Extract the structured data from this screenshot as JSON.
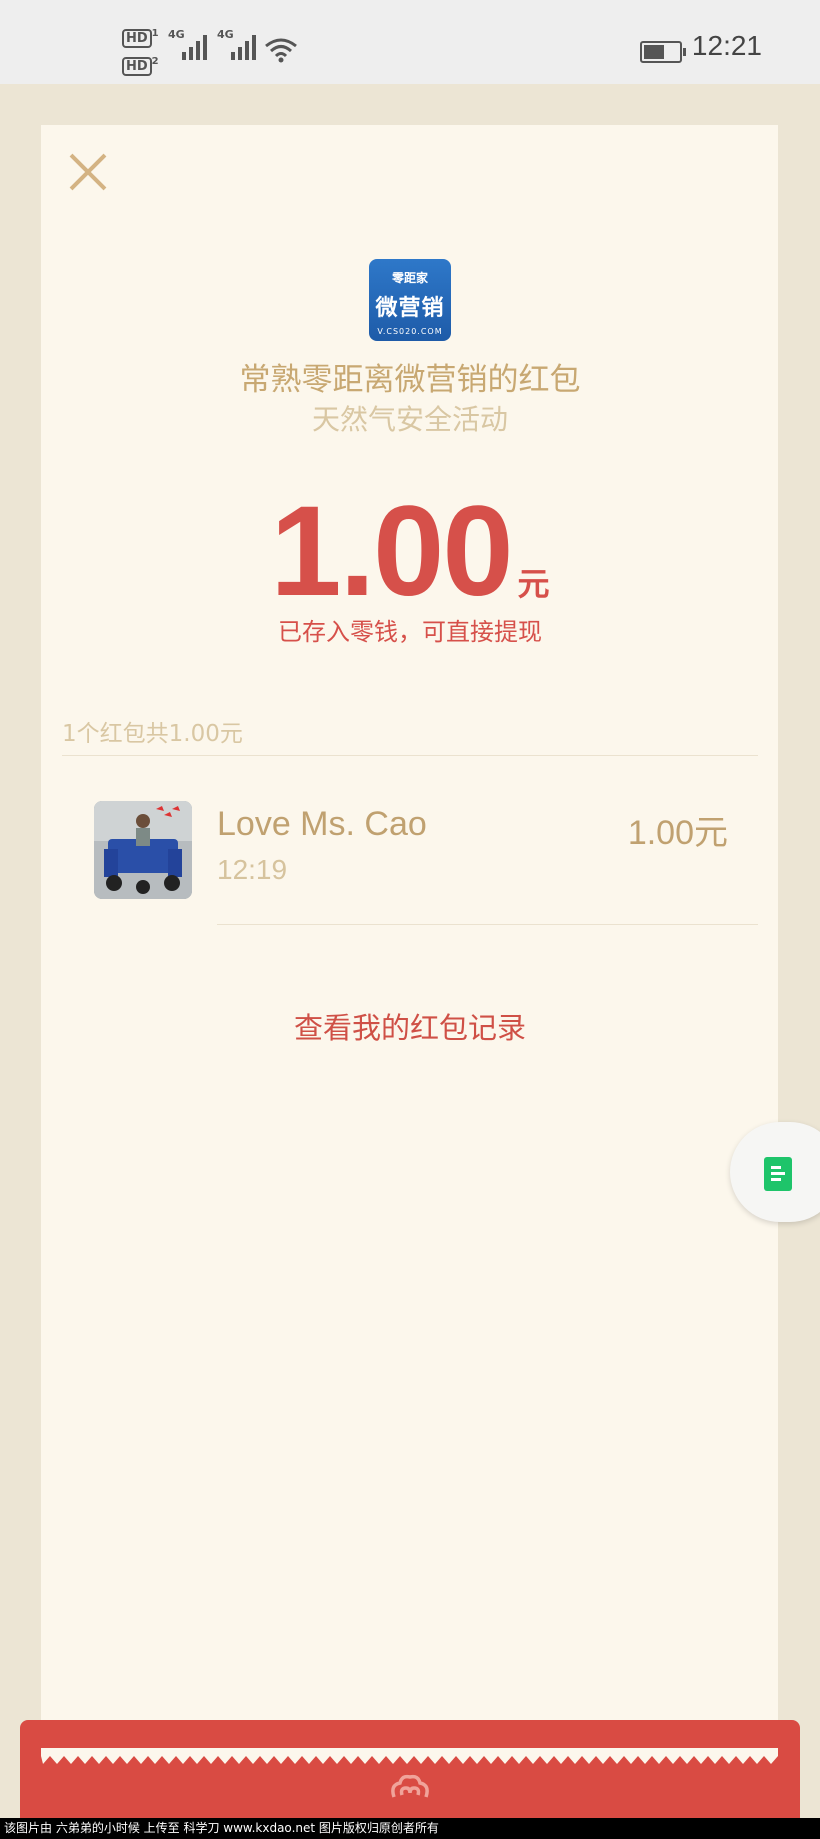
{
  "status_bar": {
    "sim1": "HD",
    "sim1_index": "1",
    "sim2": "HD",
    "sim2_index": "2",
    "network1": "4G",
    "network2": "4G",
    "time": "12:21"
  },
  "header": {
    "close_icon": "close-icon",
    "logo": {
      "line1": "零距家",
      "line2": "微营销",
      "line3": "V.CS020.COM"
    },
    "sender_title": "常熟零距离微营销的红包",
    "subtitle": "天然气安全活动"
  },
  "amount": {
    "value": "1.00",
    "unit": "元",
    "note": "已存入零钱，可直接提现"
  },
  "summary": "1个红包共1.00元",
  "recipients": [
    {
      "name": "Love Ms. Cao",
      "time": "12:19",
      "amount": "1.00元"
    }
  ],
  "records_link": "查看我的红包记录",
  "floating_button": {
    "icon": "document-icon"
  },
  "watermark": "该图片由 六弟弟的小时候 上传至 科学刀 www.kxdao.net 图片版权归原创者所有",
  "colors": {
    "accent_red": "#d6504a",
    "gold_text": "#c8a872",
    "card_bg": "#fcf7ec",
    "page_bg": "#ece5d4"
  }
}
